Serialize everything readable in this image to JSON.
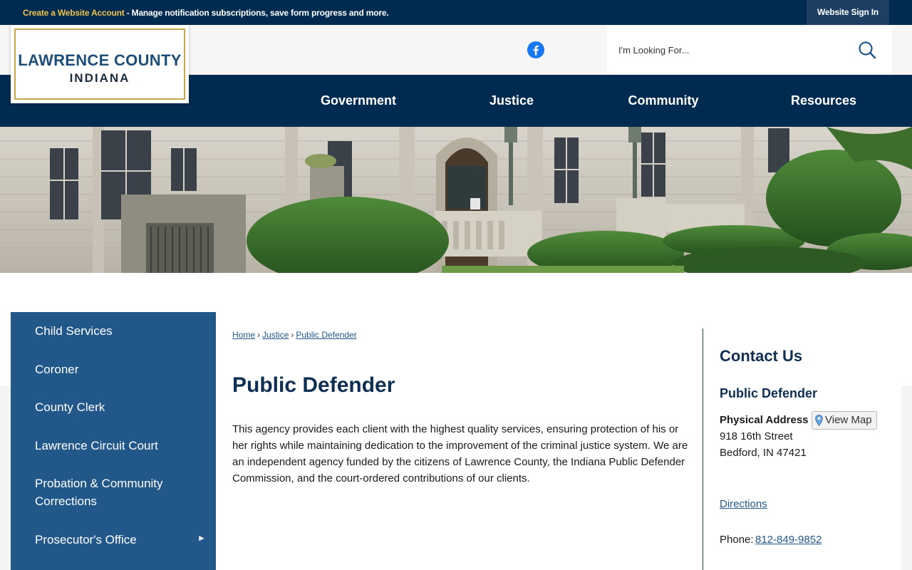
{
  "topbar": {
    "account_link": "Create a Website Account",
    "account_desc": " - Manage notification subscriptions, save form progress and more.",
    "signin": "Website Sign In"
  },
  "logo": {
    "line1": "LAWRENCE COUNTY",
    "line2": "INDIANA"
  },
  "social": {
    "facebook_icon": "facebook-icon"
  },
  "search": {
    "placeholder": "I'm Looking For...",
    "icon": "search-icon"
  },
  "nav": {
    "items": [
      "Government",
      "Justice",
      "Community",
      "Resources"
    ]
  },
  "sidebar": {
    "items": [
      {
        "label": "Child Services",
        "has_children": false
      },
      {
        "label": "Coroner",
        "has_children": false
      },
      {
        "label": "County Clerk",
        "has_children": false
      },
      {
        "label": "Lawrence Circuit Court",
        "has_children": false
      },
      {
        "label": "Probation & Community Corrections",
        "has_children": false
      },
      {
        "label": "Prosecutor's Office",
        "has_children": true
      }
    ],
    "expand_glyph": "►"
  },
  "breadcrumb": {
    "items": [
      "Home",
      "Justice",
      "Public Defender"
    ],
    "separator": "›"
  },
  "page": {
    "title": "Public Defender",
    "intro": "This agency provides each client with the highest quality services, ensuring protection of his or her rights while maintaining dedication to the improvement of the criminal justice system. We are an independent agency funded by the citizens of Lawrence County, the Indiana Public Defender Commission, and the court-ordered contributions of our clients."
  },
  "contact": {
    "heading": "Contact Us",
    "name": "Public Defender",
    "address_label": "Physical Address",
    "view_map": "View Map",
    "address_line1": "918 16th Street",
    "address_line2": "Bedford, IN 47421",
    "directions": "Directions",
    "phone_label": "Phone: ",
    "phone": "812-849-9852"
  },
  "colors": {
    "navy": "#002b50",
    "sidebar_blue": "#215889",
    "gold": "#f2c14e",
    "link_blue": "#215889"
  }
}
